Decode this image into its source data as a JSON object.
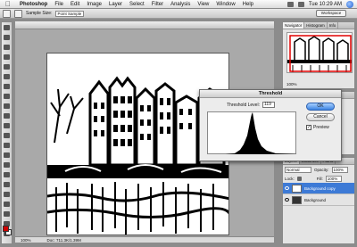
{
  "menubar": {
    "app_name": "Photoshop",
    "items": [
      "File",
      "Edit",
      "Image",
      "Layer",
      "Select",
      "Filter",
      "Analysis",
      "View",
      "Window",
      "Help"
    ],
    "clock": "Tue 10:29 AM"
  },
  "options_bar": {
    "sample_size_label": "Sample Size:",
    "sample_size_value": "Point Sample",
    "workspace_label": "Workspace"
  },
  "document": {
    "zoom": "100%",
    "doc_info": "Doc: 711.3K/1.39M"
  },
  "navigator_panel": {
    "tabs": [
      "Navigator",
      "Histogram",
      "Info"
    ],
    "zoom": "100%"
  },
  "history_panel": {
    "tabs": [
      "History",
      "Actions"
    ]
  },
  "layers_panel": {
    "tabs": [
      "Layers",
      "Channels",
      "Paths"
    ],
    "blend_mode": "Normal",
    "opacity_label": "Opacity:",
    "opacity_value": "100%",
    "lock_label": "Lock:",
    "fill_label": "Fill:",
    "fill_value": "100%",
    "layers": [
      {
        "name": "Background copy",
        "selected": true
      },
      {
        "name": "Background",
        "selected": false
      }
    ]
  },
  "threshold_dialog": {
    "title": "Threshold",
    "level_label": "Threshold Level:",
    "level_value": "119",
    "ok_label": "OK",
    "cancel_label": "Cancel",
    "preview_label": "Preview",
    "preview_checked": true
  },
  "colors": {
    "accent_blue": "#3c83e2",
    "foreground_swatch": "#d10000",
    "background_swatch": "#ffffff"
  }
}
